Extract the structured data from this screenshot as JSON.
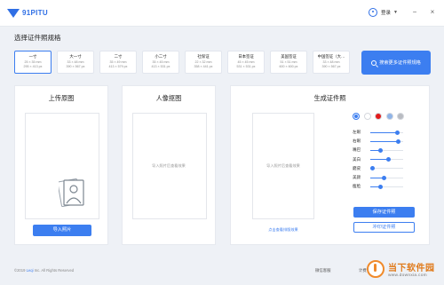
{
  "app": {
    "logo_text": "91PITU",
    "user_label": "登录",
    "win_min": "−",
    "win_close": "×"
  },
  "spec_section": {
    "title": "选择证件照规格"
  },
  "specs": [
    {
      "name": "一寸",
      "size_mm": "25 × 35 mm",
      "size_px": "295 × 413 px",
      "active": true
    },
    {
      "name": "大一寸",
      "size_mm": "33 × 48 mm",
      "size_px": "390 × 567 px",
      "active": false
    },
    {
      "name": "二寸",
      "size_mm": "35 × 49 mm",
      "size_px": "413 × 579 px",
      "active": false
    },
    {
      "name": "小二寸",
      "size_mm": "35 × 45 mm",
      "size_px": "413 × 531 px",
      "active": false
    },
    {
      "name": "社保证",
      "size_mm": "22 × 32 mm",
      "size_px": "358 × 441 px",
      "active": false
    },
    {
      "name": "日本签证",
      "size_mm": "45 × 45 mm",
      "size_px": "531 × 531 px",
      "active": false
    },
    {
      "name": "美国签证",
      "size_mm": "51 × 51 mm",
      "size_px": "600 × 600 px",
      "active": false
    },
    {
      "name": "中国签证（大…",
      "size_mm": "33 × 48 mm",
      "size_px": "390 × 567 px",
      "active": false
    }
  ],
  "search_more_label": "搜索更多证件照规格",
  "upload_panel": {
    "title": "上传原图",
    "button": "导入照片"
  },
  "cutout_panel": {
    "title": "人像抠图",
    "hint": "导入照片后查看效果"
  },
  "result_panel": {
    "title": "生成证件照",
    "hint": "导入照片后查看效果",
    "link": "点击查看排版效果",
    "save_button": "保存证件照",
    "print_button": "冲印证件照"
  },
  "background_colors": [
    "#3c7ef0",
    "#ffffff",
    "#e21b1b",
    "#8fb4e8",
    "#b9bcc2"
  ],
  "sliders": [
    {
      "label": "左眼",
      "value": 0.82
    },
    {
      "label": "右眼",
      "value": 0.86
    },
    {
      "label": "嘴巴",
      "value": 0.3
    },
    {
      "label": "美白",
      "value": 0.55
    },
    {
      "label": "磨皮",
      "value": 0.08
    },
    {
      "label": "美颜",
      "value": 0.42
    },
    {
      "label": "瘦脸",
      "value": 0.3
    }
  ],
  "footer": {
    "copyright_pre": "©2019",
    "copyright_brand": "Leqi",
    "copyright_post": "Inc. All Rights Reserved",
    "link_service": "微信客服",
    "link_feedback": "计费"
  },
  "watermark": {
    "main": "当下软件园",
    "sub": "www.downxia.com"
  }
}
